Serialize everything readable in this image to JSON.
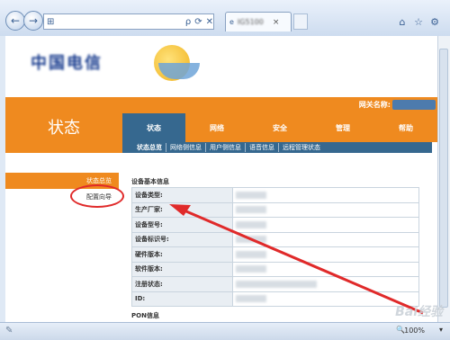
{
  "browser": {
    "back_icon": "back-arrow-icon",
    "forward_icon": "forward-arrow-icon",
    "address_search_symbol": "ρ",
    "address_icons": [
      "refresh-icon",
      "stop-icon"
    ],
    "tab_label": "IG5100",
    "tab_close": "×",
    "window_icons": [
      "home-icon",
      "star-icon",
      "gear-icon"
    ],
    "zoom": "100%"
  },
  "header": {
    "logo_text": "中国电信",
    "gateway_label": "网关名称:",
    "page_title": "状态"
  },
  "menu": {
    "tabs": [
      {
        "label": "状态",
        "active": true
      },
      {
        "label": "网络",
        "active": false
      },
      {
        "label": "安全",
        "active": false
      },
      {
        "label": "管理",
        "active": false
      },
      {
        "label": "帮助",
        "active": false
      }
    ],
    "sub_tabs": [
      {
        "label": "状态总览",
        "active": true
      },
      {
        "label": "网络侧信息",
        "active": false
      },
      {
        "label": "用户侧信息",
        "active": false
      },
      {
        "label": "语音信息",
        "active": false
      },
      {
        "label": "远程管理状态",
        "active": false
      }
    ]
  },
  "sidebar": {
    "items": [
      {
        "label": "状态总览",
        "active": true
      },
      {
        "label": "配置向导",
        "active": false
      }
    ]
  },
  "content": {
    "section_title": "设备基本信息",
    "rows": [
      {
        "label": "设备类型:",
        "value": ""
      },
      {
        "label": "生产厂家:",
        "value": ""
      },
      {
        "label": "设备型号:",
        "value": ""
      },
      {
        "label": "设备标识号:",
        "value": ""
      },
      {
        "label": "硬件版本:",
        "value": ""
      },
      {
        "label": "软件版本:",
        "value": ""
      },
      {
        "label": "注册状态:",
        "value": ""
      },
      {
        "label": "ID:",
        "value": ""
      }
    ],
    "next_section": "PON信息"
  },
  "annotation": {
    "color": "#e02a2a"
  },
  "watermark": "Bai经验"
}
